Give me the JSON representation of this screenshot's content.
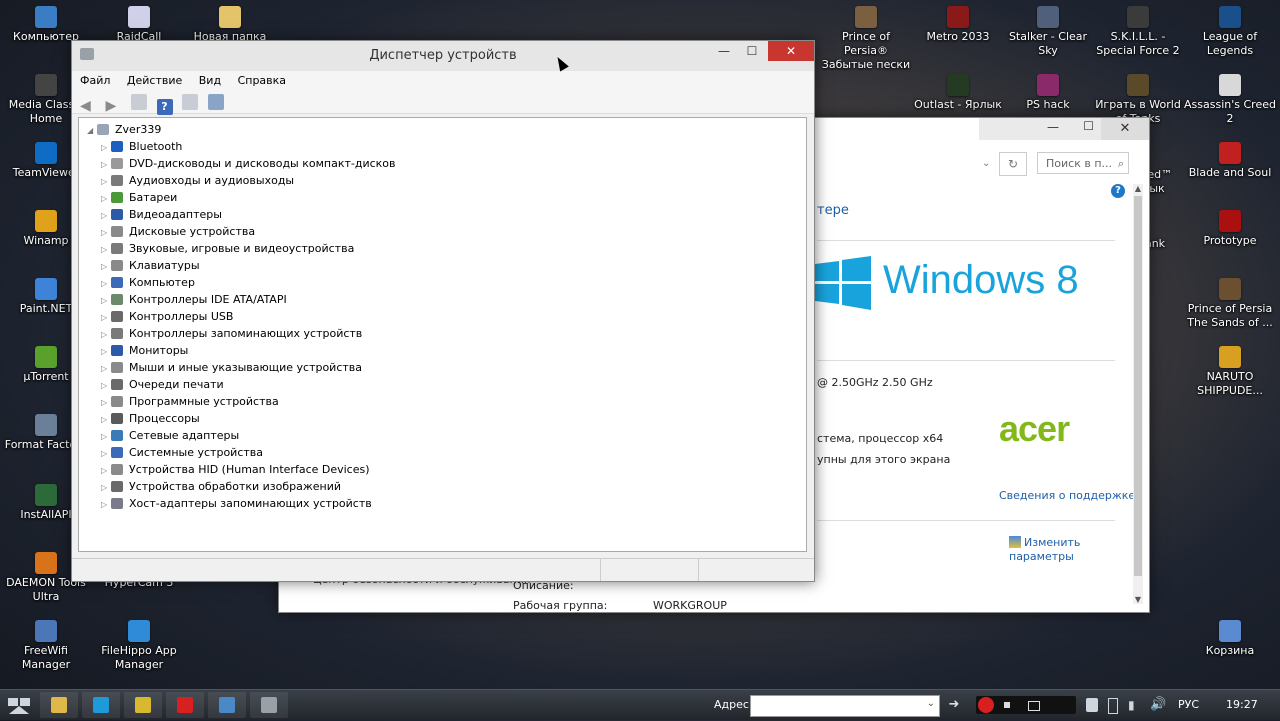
{
  "desktop": {
    "left_icons": [
      {
        "label": "Компьютер",
        "color": "#3b7dc4"
      },
      {
        "label": "Media Classic Home",
        "color": "#444"
      },
      {
        "label": "TeamViewer",
        "color": "#0e6cc4"
      },
      {
        "label": "Winamp",
        "color": "#e0a21a"
      },
      {
        "label": "Paint.NET",
        "color": "#3d84d8"
      },
      {
        "label": "µTorrent",
        "color": "#5aa02c"
      },
      {
        "label": "Format Factory",
        "color": "#6b7f99"
      },
      {
        "label": "InstAllAPI",
        "color": "#2c6a3a"
      },
      {
        "label": "DAEMON Tools Ultra",
        "color": "#d8731c"
      },
      {
        "label": "FreeWifi Manager",
        "color": "#4b77b8"
      }
    ],
    "col2_icons": [
      {
        "label": "RaidCall",
        "color": "#d0d0e8"
      },
      {
        "label": "HyperCam 3",
        "color": "#2a6fb8"
      },
      {
        "label": "FileHippo App Manager",
        "color": "#2f8bd8"
      }
    ],
    "col3_icons": [
      {
        "label": "Новая папка",
        "color": "#e3c46a"
      }
    ],
    "right_icons_row1": [
      {
        "label": "Prince of Persia® Забытые пески",
        "color": "#7a6040"
      },
      {
        "label": "Metro 2033",
        "color": "#8a1a1a"
      },
      {
        "label": "Stalker - Clear Sky",
        "color": "#50607a"
      },
      {
        "label": "S.K.I.L.L. - Special Force 2",
        "color": "#3b3b3b"
      },
      {
        "label": "League of Legends",
        "color": "#1a4f8a"
      }
    ],
    "right_icons_row2": [
      {
        "label": "Outlast - Ярлык",
        "color": "#253a22"
      },
      {
        "label": "PS hack",
        "color": "#8a2a6a"
      },
      {
        "label": "Играть в World of Tanks",
        "color": "#5a4a2a"
      },
      {
        "label": "Assassin's Creed 2",
        "color": "#d8d8d8"
      }
    ],
    "right_col_icons": [
      {
        "label": "Blade and Soul",
        "color": "#c02020"
      },
      {
        "label": "Prototype",
        "color": "#aa1010"
      },
      {
        "label": "Prince of Persia The Sands of ...",
        "color": "#6a5030"
      },
      {
        "label": "NARUTO SHIPPUDE...",
        "color": "#d8a020"
      },
      {
        "label": "Корзина",
        "color": "#5a8ad0"
      }
    ],
    "partial_labels": {
      "speed": "speed™ рлык",
      "ank": "ank"
    }
  },
  "sysprops": {
    "search_placeholder": "Поиск в п...",
    "partial_link": "тере",
    "windows_logo_text": "Windows 8",
    "cpu_text": "@ 2.50GHz   2.50 GHz",
    "sys_type": "стема, процессор x64",
    "pen_text": "упны для этого экрана",
    "acer_logo": "acer",
    "support_link": "Сведения о поддержке",
    "change_params": "Изменить параметры",
    "bottom_left": "Центр безопасности и обслуживания",
    "desc_label": "Описание:",
    "workgroup_label": "Рабочая группа:",
    "workgroup_value": "WORKGROUP"
  },
  "devmgr": {
    "title": "Диспетчер устройств",
    "menu": [
      "Файл",
      "Действие",
      "Вид",
      "Справка"
    ],
    "root": "Zver339",
    "items": [
      {
        "label": "Bluetooth",
        "color": "#1f5fbf"
      },
      {
        "label": "DVD-дисководы и дисководы компакт-дисков",
        "color": "#9a9a9a"
      },
      {
        "label": "Аудиовходы и аудиовыходы",
        "color": "#7a7a7a"
      },
      {
        "label": "Батареи",
        "color": "#4a9a3a"
      },
      {
        "label": "Видеоадаптеры",
        "color": "#2a5aa8"
      },
      {
        "label": "Дисковые устройства",
        "color": "#8a8a8a"
      },
      {
        "label": "Звуковые, игровые и видеоустройства",
        "color": "#7a7a7a"
      },
      {
        "label": "Клавиатуры",
        "color": "#8a8a8a"
      },
      {
        "label": "Компьютер",
        "color": "#3a6ab8"
      },
      {
        "label": "Контроллеры IDE ATA/ATAPI",
        "color": "#6a8a6a"
      },
      {
        "label": "Контроллеры USB",
        "color": "#6a6a6a"
      },
      {
        "label": "Контроллеры запоминающих устройств",
        "color": "#7a7a7a"
      },
      {
        "label": "Мониторы",
        "color": "#2a5aa8"
      },
      {
        "label": "Мыши и иные указывающие устройства",
        "color": "#8a8a8a"
      },
      {
        "label": "Очереди печати",
        "color": "#6a6a6a"
      },
      {
        "label": "Программные устройства",
        "color": "#8a8a8a"
      },
      {
        "label": "Процессоры",
        "color": "#5a5a5a"
      },
      {
        "label": "Сетевые адаптеры",
        "color": "#3a7ab8"
      },
      {
        "label": "Системные устройства",
        "color": "#3a6ab8"
      },
      {
        "label": "Устройства HID (Human Interface Devices)",
        "color": "#8a8a8a"
      },
      {
        "label": "Устройства обработки изображений",
        "color": "#6a6a6a"
      },
      {
        "label": "Хост-адаптеры запоминающих устройств",
        "color": "#7a7a8a"
      }
    ]
  },
  "taskbar": {
    "address_label": "Адрес",
    "lang": "РУС",
    "time": "19:27",
    "buttons": [
      {
        "name": "file-explorer",
        "color": "#e0b84a"
      },
      {
        "name": "skype",
        "color": "#1e9ad8"
      },
      {
        "name": "chrome",
        "color": "#d8b830"
      },
      {
        "name": "opera",
        "color": "#d82020"
      },
      {
        "name": "system-properties",
        "color": "#4a88c8"
      },
      {
        "name": "device-manager",
        "color": "#9aa0a8"
      }
    ]
  }
}
